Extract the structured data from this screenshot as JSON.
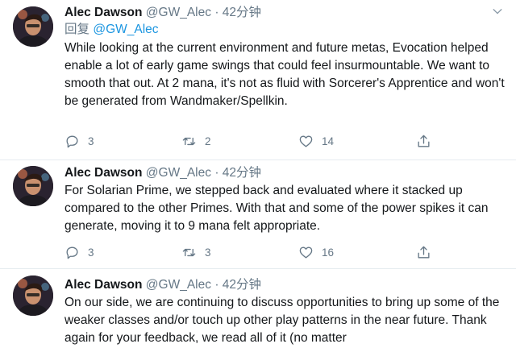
{
  "tweets": [
    {
      "author": "Alec Dawson",
      "handle": "@GW_Alec",
      "separator": "·",
      "time": "42分钟",
      "reply_prefix": "回复",
      "reply_to": "@GW_Alec",
      "text": "While looking at the current environment and future metas, Evocation helped enable a lot of early game swings that could feel insurmountable. We want to smooth that out. At 2 mana, it's not as fluid with Sorcerer's Apprentice and won't be generated from Wandmaker/Spellkin.",
      "replies": "3",
      "retweets": "2",
      "likes": "14"
    },
    {
      "author": "Alec Dawson",
      "handle": "@GW_Alec",
      "separator": "·",
      "time": "42分钟",
      "text": "For Solarian Prime, we stepped back and evaluated where it stacked up compared to the other Primes. With that and some of the power spikes it can generate, moving it to 9 mana felt appropriate.",
      "replies": "3",
      "retweets": "3",
      "likes": "16"
    },
    {
      "author": "Alec Dawson",
      "handle": "@GW_Alec",
      "separator": "·",
      "time": "42分钟",
      "text": "On our side, we are continuing to discuss opportunities to bring up some of the weaker classes and/or touch up other play patterns in the near future. Thank again for your feedback, we read all of it (no matter"
    }
  ],
  "icons": {
    "reply": "comment-bubble-icon",
    "retweet": "retweet-arrows-icon",
    "like": "heart-icon",
    "share": "share-upload-icon",
    "more": "chevron-down-icon"
  },
  "colors": {
    "name": "#14171a",
    "secondary": "#657786",
    "link": "#1b95e0",
    "divider": "#e6ecf0"
  }
}
